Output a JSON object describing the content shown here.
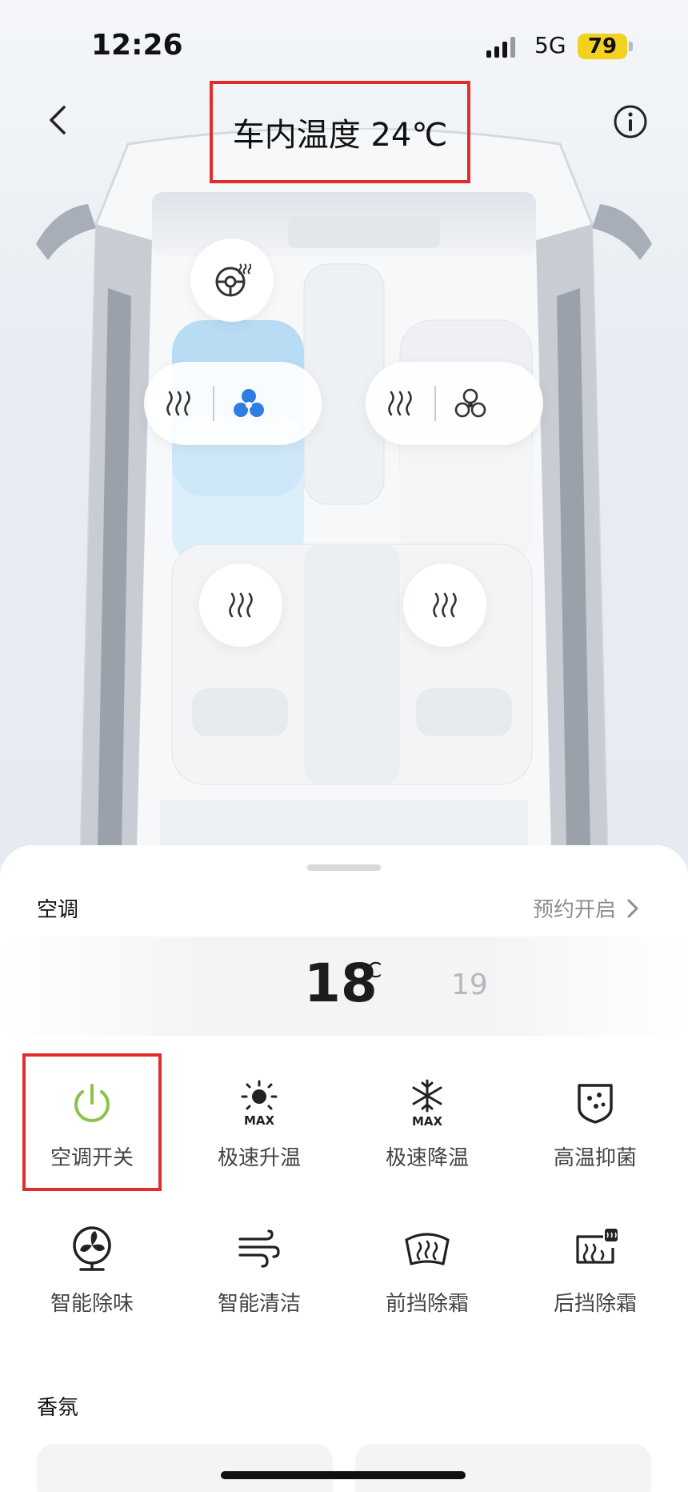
{
  "status": {
    "time": "12:26",
    "network": "5G",
    "battery": "79"
  },
  "header": {
    "title": "车内温度 24℃",
    "back_icon": "chevron-left-icon",
    "info_icon": "info-icon"
  },
  "cabin": {
    "steering_heat_icon": "steering-wheel-heat-icon",
    "driver": {
      "heat_icon": "seat-heat-icon",
      "vent_icon": "seat-vent-fan-icon",
      "vent_active": true
    },
    "passenger": {
      "heat_icon": "seat-heat-icon",
      "vent_icon": "seat-vent-fan-icon",
      "vent_active": false
    },
    "rear_left_heat_icon": "seat-heat-icon",
    "rear_right_heat_icon": "seat-heat-icon",
    "accent_color": "#2f7de1"
  },
  "climate": {
    "section_title": "空调",
    "schedule_label": "预约开启",
    "temperature": "18",
    "unit": "°C",
    "next_temperature": "19",
    "controls": [
      {
        "label": "空调开关",
        "icon": "power-icon",
        "color": "#8bc34a"
      },
      {
        "label": "极速升温",
        "icon": "sun-max-icon"
      },
      {
        "label": "极速降温",
        "icon": "snowflake-max-icon"
      },
      {
        "label": "高温抑菌",
        "icon": "shield-dots-icon"
      },
      {
        "label": "智能除味",
        "icon": "fan-icon"
      },
      {
        "label": "智能清洁",
        "icon": "wind-icon"
      },
      {
        "label": "前挡除霜",
        "icon": "front-defrost-icon"
      },
      {
        "label": "后挡除霜",
        "icon": "rear-defrost-icon"
      }
    ],
    "max_text": "MAX"
  },
  "fragrance": {
    "section_title": "香氛"
  }
}
